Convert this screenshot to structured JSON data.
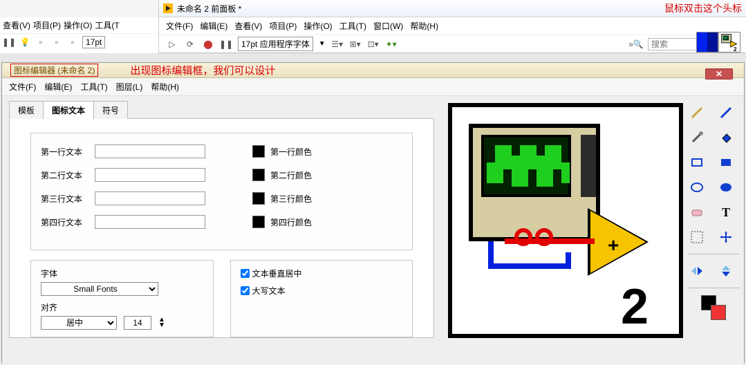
{
  "partial_window": {
    "menus": [
      "查看(V)",
      "项目(P)",
      "操作(O)",
      "工具(T"
    ],
    "font_size": "17pt"
  },
  "front_panel": {
    "title": "未命名 2 前面板 *",
    "menus": [
      "文件(F)",
      "编辑(E)",
      "查看(V)",
      "项目(P)",
      "操作(O)",
      "工具(T)",
      "窗口(W)",
      "帮助(H)"
    ],
    "font_label": "17pt 应用程序字体",
    "search_placeholder": "搜索"
  },
  "annotation_top": "鼠标双击这个头标",
  "editor": {
    "title": "图标编辑器 (未命名 2)",
    "annotation": "出现图标编辑框，我们可以设计",
    "menus": [
      "文件(F)",
      "编辑(E)",
      "工具(T)",
      "图层(L)",
      "帮助(H)"
    ],
    "tabs": [
      "模板",
      "图标文本",
      "符号"
    ],
    "active_tab": 1,
    "rows": [
      {
        "label": "第一行文本",
        "color_label": "第一行颜色"
      },
      {
        "label": "第二行文本",
        "color_label": "第二行颜色"
      },
      {
        "label": "第三行文本",
        "color_label": "第三行颜色"
      },
      {
        "label": "第四行文本",
        "color_label": "第四行颜色"
      }
    ],
    "font_label": "字体",
    "font_value": "Small Fonts",
    "align_label": "对齐",
    "align_value": "居中",
    "size_value": "14",
    "chk1": "文本垂直居中",
    "chk2": "大写文本",
    "canvas_number": "2"
  },
  "tools": [
    "pencil",
    "line",
    "eyedropper",
    "fill",
    "rect",
    "rect-filled",
    "ellipse",
    "ellipse-filled",
    "eraser",
    "text",
    "select",
    "move",
    "flip-h",
    "flip-v"
  ]
}
